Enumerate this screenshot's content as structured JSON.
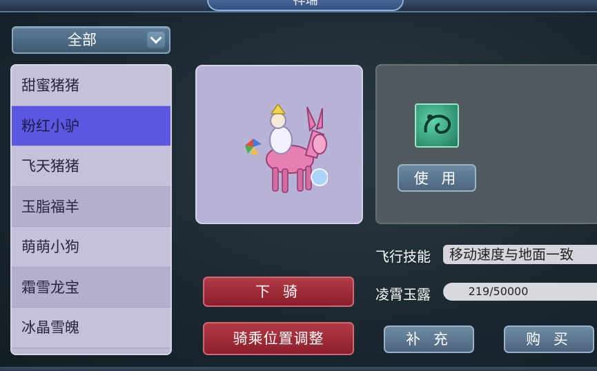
{
  "window": {
    "title": "祥瑞"
  },
  "filter": {
    "selected": "全部"
  },
  "mount_list": {
    "items": [
      {
        "label": "甜蜜猪猪",
        "selected": false
      },
      {
        "label": "粉红小驴",
        "selected": true
      },
      {
        "label": "飞天猪猪",
        "selected": false
      },
      {
        "label": "玉脂福羊",
        "selected": false
      },
      {
        "label": "萌萌小狗",
        "selected": false
      },
      {
        "label": "霜雪龙宝",
        "selected": false
      },
      {
        "label": "冰晶雪魄",
        "selected": false
      }
    ]
  },
  "skill": {
    "icon": "flight-skill-icon",
    "use_label": "使 用"
  },
  "flight_skill": {
    "label": "飞行技能",
    "value": "移动速度与地面一致"
  },
  "dew": {
    "label": "凌霄玉露",
    "current": 219,
    "max": 50000,
    "text": "219/50000"
  },
  "buttons": {
    "dismount": "下 骑",
    "adjust_position": "骑乘位置调整",
    "refill": "补 充",
    "buy": "购 买"
  },
  "colors": {
    "selected_row": "#5b57e0",
    "red_button": "#a0303a",
    "blue_button": "#5d7890"
  }
}
